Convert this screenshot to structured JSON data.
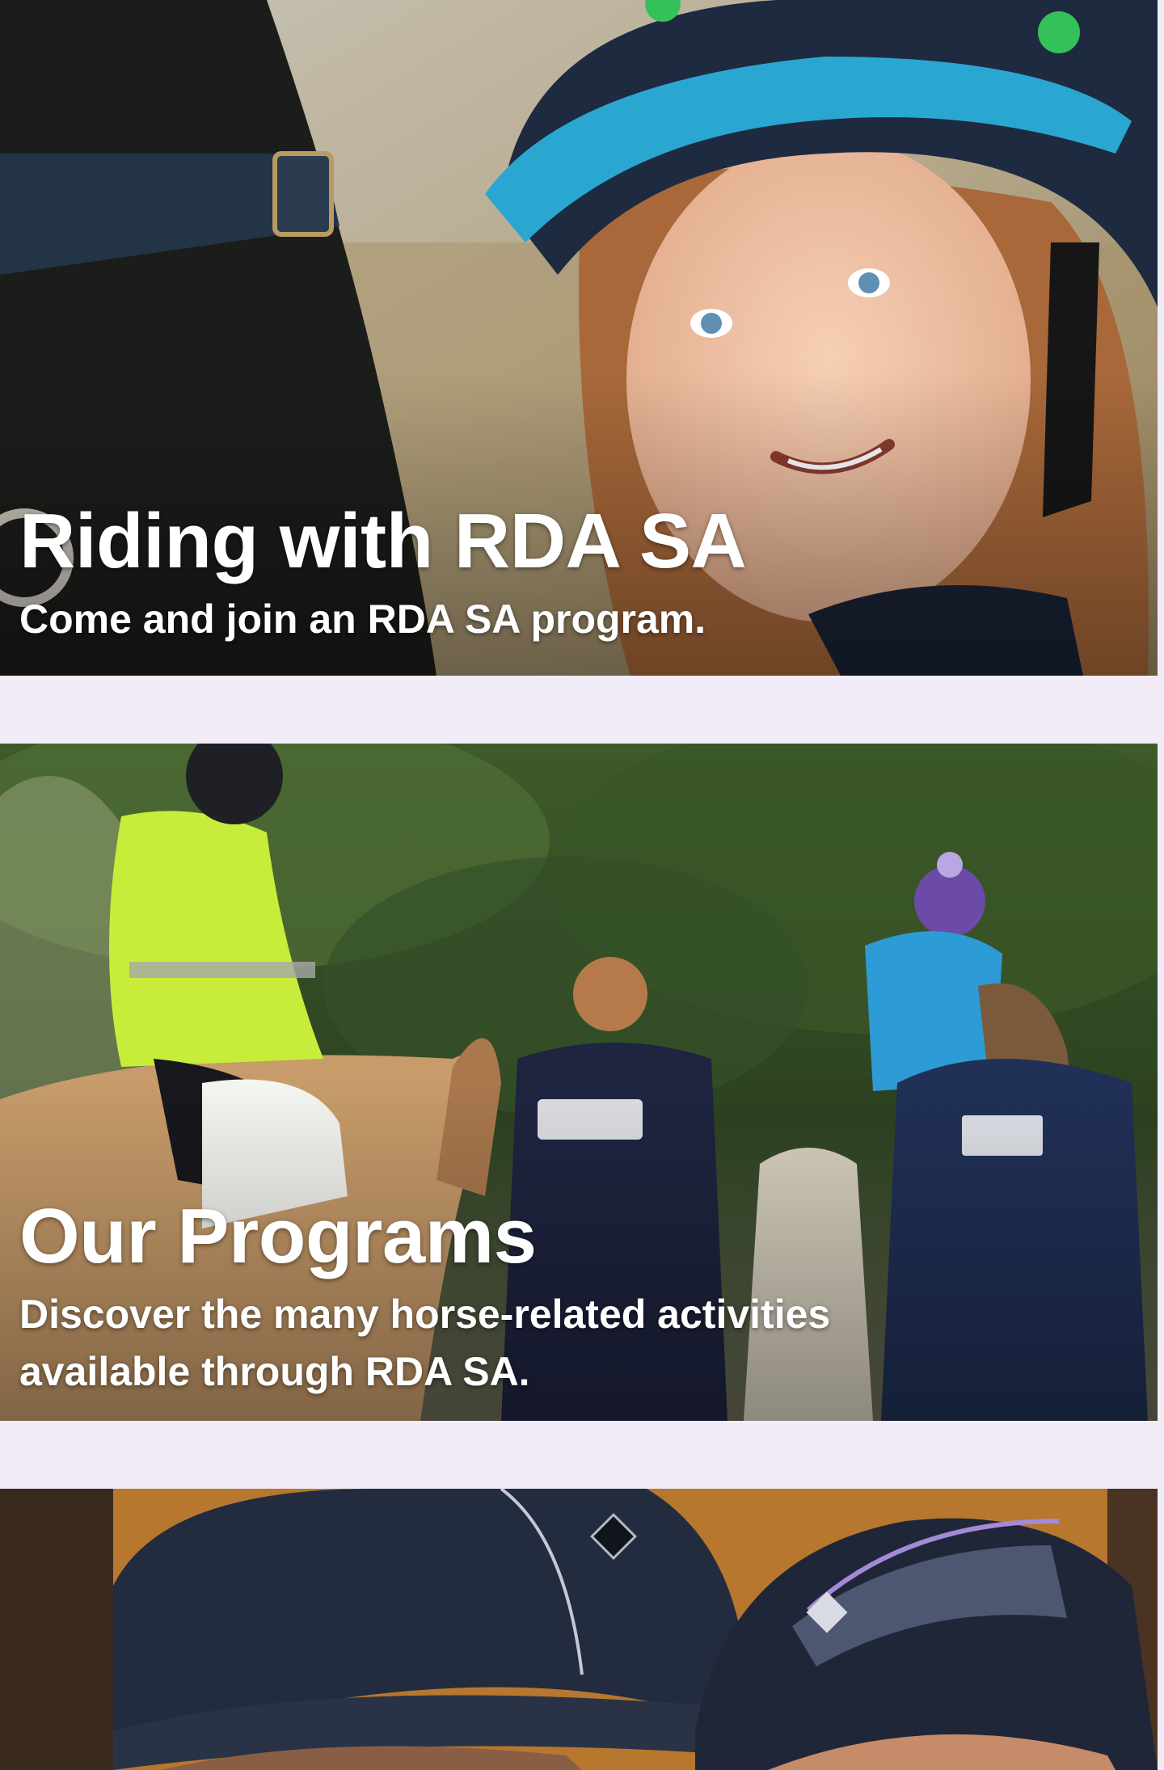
{
  "cards": [
    {
      "title": "Riding with RDA SA",
      "subtitle": "Come and join an RDA SA program."
    },
    {
      "title": "Our Programs",
      "subtitle": "Discover the many horse-related activities available through RDA SA."
    },
    {
      "title": "",
      "subtitle": ""
    }
  ],
  "colors": {
    "page_background": "#f1ecf8",
    "overlay_text": "#ffffff"
  }
}
